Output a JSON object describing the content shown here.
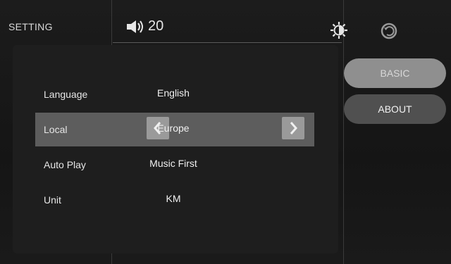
{
  "header": {
    "title": "SETTING",
    "volume_value": "20",
    "icons": [
      "volume-icon",
      "brightness-icon",
      "back-icon"
    ]
  },
  "settings": {
    "rows": [
      {
        "label": "Language",
        "value": "English"
      },
      {
        "label": "Local",
        "value": "Europe",
        "selected": true
      },
      {
        "label": "Auto Play",
        "value": "Music First"
      },
      {
        "label": "Unit",
        "value": "KM"
      }
    ]
  },
  "side_menu": {
    "basic_label": "BASIC",
    "about_label": "ABOUT",
    "active": "BASIC"
  },
  "colors": {
    "background": "#151515",
    "selected_row": "#5d5d5d",
    "active_tab": "#8f8f8f",
    "inactive_tab": "#505050"
  }
}
